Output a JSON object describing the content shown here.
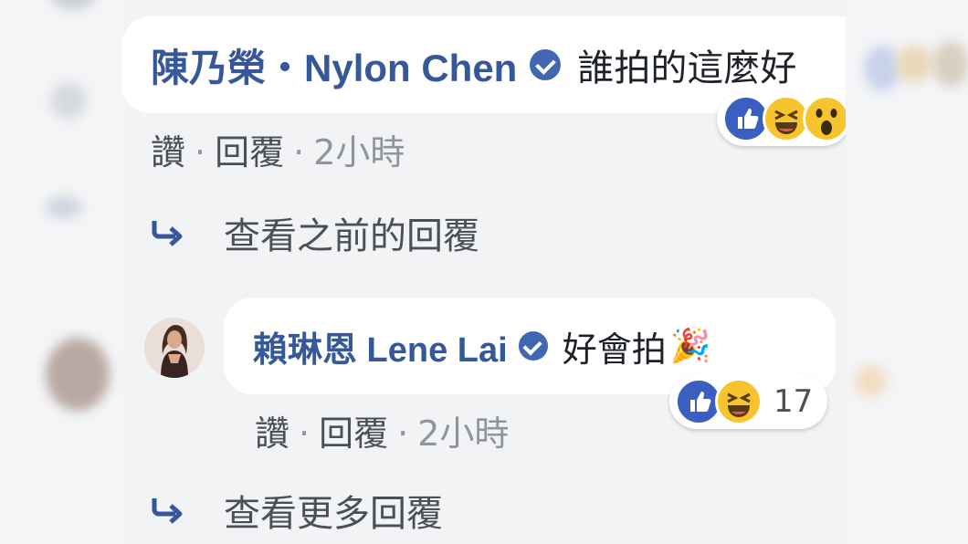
{
  "comments": [
    {
      "author": "陳乃榮‧Nylon Chen",
      "text": "誰拍的這麼好",
      "actions": {
        "like": "讚",
        "reply": "回覆",
        "time": "2小時"
      },
      "reactions": [
        "like",
        "haha",
        "wow"
      ]
    },
    {
      "author": "賴琳恩 Lene Lai",
      "text": "好會拍",
      "emoji": "🎉",
      "actions": {
        "like": "讚",
        "reply": "回覆",
        "time": "2小時"
      },
      "reactions": [
        "like",
        "haha"
      ],
      "reaction_count": "17"
    }
  ],
  "view_previous": "查看之前的回覆",
  "view_more": "查看更多回覆",
  "separator": "·",
  "colors": {
    "name": "#365899",
    "like_blue": "#3b5fc0",
    "haha_yellow": "#f7c42d",
    "panel_bg": "#f2f3f5"
  }
}
